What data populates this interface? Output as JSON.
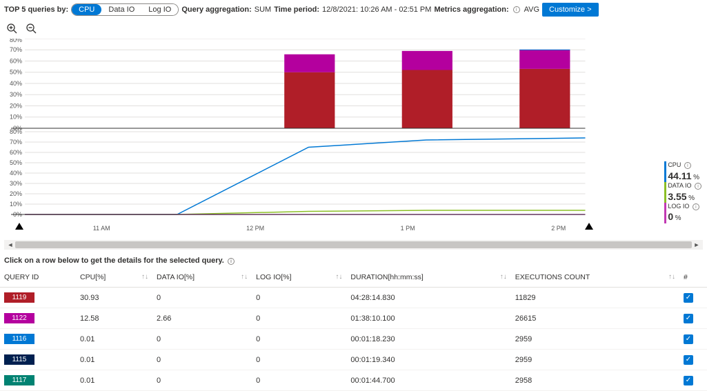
{
  "header": {
    "top5_label": "TOP 5 queries by:",
    "tabs": {
      "cpu": "CPU",
      "dataio": "Data IO",
      "logio": "Log IO",
      "active": "cpu"
    },
    "query_agg_label": "Query aggregation:",
    "query_agg_value": "SUM",
    "time_period_label": "Time period:",
    "time_period_value": "12/8/2021: 10:26 AM - 02:51 PM",
    "metrics_agg_label": "Metrics aggregation:",
    "metrics_agg_value": "AVG",
    "customize_label": "Customize >"
  },
  "chart_data": [
    {
      "type": "bar",
      "stacked": true,
      "title": "",
      "xlabel": "",
      "ylabel": "",
      "ylim": [
        0,
        80
      ],
      "yticks": [
        "0%",
        "10%",
        "20%",
        "30%",
        "40%",
        "50%",
        "60%",
        "70%",
        "80%"
      ],
      "categories": [
        "11 AM",
        "12 PM",
        "1 PM",
        "2 PM"
      ],
      "series": [
        {
          "name": "1122",
          "color": "#b4009e",
          "values": [
            0,
            16,
            17,
            17
          ]
        },
        {
          "name": "1119",
          "color": "#b01e28",
          "values": [
            0,
            50,
            52,
            53
          ]
        }
      ]
    },
    {
      "type": "line",
      "title": "",
      "xlabel": "",
      "ylabel": "",
      "ylim": [
        0,
        80
      ],
      "yticks": [
        "0%",
        "10%",
        "20%",
        "30%",
        "40%",
        "50%",
        "60%",
        "70%",
        "80%"
      ],
      "categories": [
        "11 AM",
        "12 PM",
        "1 PM",
        "2 PM"
      ],
      "series": [
        {
          "name": "CPU",
          "color": "#0078d4",
          "values": [
            0,
            65,
            72,
            74
          ]
        },
        {
          "name": "DATA IO",
          "color": "#8cbf26",
          "values": [
            0,
            3,
            4,
            4
          ]
        },
        {
          "name": "LOG IO",
          "color": "#c239b3",
          "values": [
            0,
            0,
            0,
            0
          ]
        }
      ]
    }
  ],
  "legend": {
    "cpu_label": "CPU",
    "cpu_value": "44.11",
    "cpu_pct": "%",
    "dataio_label": "DATA IO",
    "dataio_value": "3.55",
    "dataio_pct": "%",
    "logio_label": "LOG IO",
    "logio_value": "0",
    "logio_pct": "%"
  },
  "xaxis": {
    "t0": "11 AM",
    "t1": "12 PM",
    "t2": "1 PM",
    "t3": "2 PM"
  },
  "instruction": "Click on a row below to get the details for the selected query.",
  "table": {
    "columns": {
      "query_id": "QUERY ID",
      "cpu": "CPU[%]",
      "dataio": "DATA IO[%]",
      "logio": "LOG IO[%]",
      "duration": "DURATION[hh:mm:ss]",
      "executions": "EXECUTIONS COUNT",
      "check": "#"
    },
    "rows": [
      {
        "id": "1119",
        "color": "#b01e28",
        "cpu": "30.93",
        "dataio": "0",
        "logio": "0",
        "duration": "04:28:14.830",
        "executions": "11829",
        "checked": true
      },
      {
        "id": "1122",
        "color": "#b4009e",
        "cpu": "12.58",
        "dataio": "2.66",
        "logio": "0",
        "duration": "01:38:10.100",
        "executions": "26615",
        "checked": true
      },
      {
        "id": "1116",
        "color": "#0078d4",
        "cpu": "0.01",
        "dataio": "0",
        "logio": "0",
        "duration": "00:01:18.230",
        "executions": "2959",
        "checked": true
      },
      {
        "id": "1115",
        "color": "#002050",
        "cpu": "0.01",
        "dataio": "0",
        "logio": "0",
        "duration": "00:01:19.340",
        "executions": "2959",
        "checked": true
      },
      {
        "id": "1117",
        "color": "#008272",
        "cpu": "0.01",
        "dataio": "0",
        "logio": "0",
        "duration": "00:01:44.700",
        "executions": "2958",
        "checked": true
      }
    ]
  }
}
